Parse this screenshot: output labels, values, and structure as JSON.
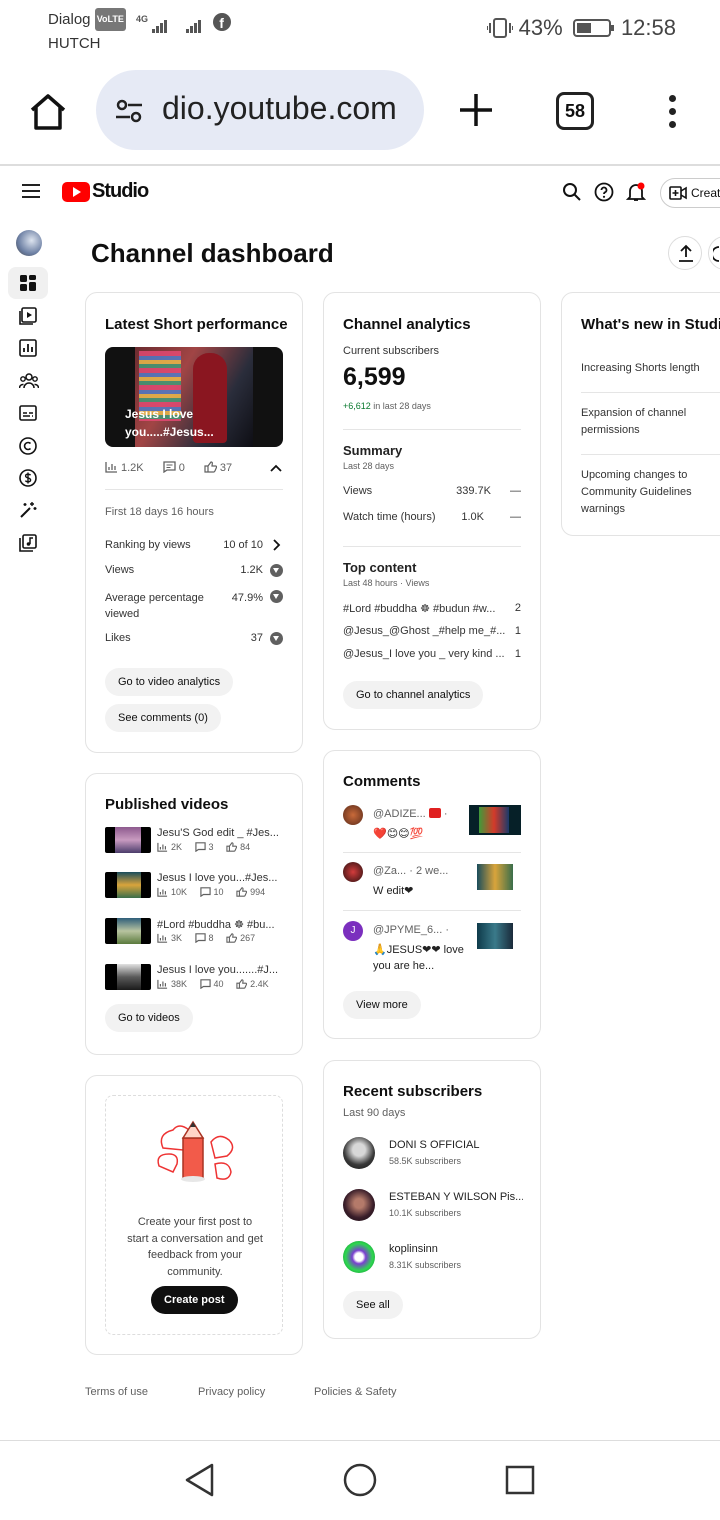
{
  "status_bar": {
    "carrier_1": "Dialog",
    "volte": "VoLTE",
    "network": "4G",
    "carrier_2": "HUTCH",
    "battery": "43%",
    "time": "12:58"
  },
  "browser": {
    "url": "dio.youtube.com",
    "tab_count": "58"
  },
  "header": {
    "logo_text": "Studio",
    "create_label": "Create"
  },
  "page": {
    "title": "Channel dashboard"
  },
  "latest_short": {
    "title": "Latest Short performance",
    "thumb_caption_1": "Jesus I love",
    "thumb_caption_2": "you.....#Jesus...",
    "views": "1.2K",
    "comments": "0",
    "likes": "37",
    "period": "First 18 days 16 hours",
    "ranking_label": "Ranking by views",
    "ranking_value": "10 of 10",
    "views_label": "Views",
    "views_value": "1.2K",
    "avg_label": "Average percentage viewed",
    "avg_value": "47.9%",
    "likes_label": "Likes",
    "likes_value": "37",
    "btn_analytics": "Go to video analytics",
    "btn_comments": "See comments (0)"
  },
  "channel_analytics": {
    "title": "Channel analytics",
    "subs_label": "Current subscribers",
    "subs_value": "6,599",
    "subs_delta": "+6,612",
    "subs_delta_period": "in last 28 days",
    "summary_title": "Summary",
    "summary_period": "Last 28 days",
    "views_label": "Views",
    "views_value": "339.7K",
    "views_trend": "—",
    "watch_label": "Watch time (hours)",
    "watch_value": "1.0K",
    "watch_trend": "—",
    "top_title": "Top content",
    "top_period": "Last 48 hours · Views",
    "top_items": [
      {
        "title": "#Lord #buddha ☸ #budun #w...",
        "views": "2"
      },
      {
        "title": "@Jesus_@Ghost _#help me_#...",
        "views": "1"
      },
      {
        "title": "@Jesus_I love you _ very kind ...",
        "views": "1"
      }
    ],
    "btn": "Go to channel analytics"
  },
  "whats_new": {
    "title": "What's new in Studio",
    "items": [
      "Increasing Shorts length",
      "Expansion of channel permissions",
      "Upcoming changes to Community Guidelines warnings"
    ]
  },
  "published": {
    "title": "Published videos",
    "videos": [
      {
        "title": "Jesu'S God edit _ #Jes...",
        "views": "2K",
        "comments": "3",
        "likes": "84"
      },
      {
        "title": "Jesus I love you...#Jes...",
        "views": "10K",
        "comments": "10",
        "likes": "994"
      },
      {
        "title": "#Lord #buddha ☸ #bu...",
        "views": "3K",
        "comments": "8",
        "likes": "267"
      },
      {
        "title": "Jesus I love you.......#J...",
        "views": "38K",
        "comments": "40",
        "likes": "2.4K"
      }
    ],
    "btn": "Go to videos"
  },
  "comments": {
    "title": "Comments",
    "items": [
      {
        "author": "@ADIZE...",
        "meta": "·",
        "text": "❤️😊😊💯"
      },
      {
        "author": "@Za...",
        "meta": "· 2 we...",
        "text": "W edit❤"
      },
      {
        "author": "@JPYME_6...",
        "meta": "·",
        "initial": "J",
        "text": "🙏JESUS❤❤ love you are he..."
      }
    ],
    "btn": "View more"
  },
  "community": {
    "text": "Create your first post to start a conversation and get feedback from your community.",
    "btn": "Create post"
  },
  "recent_subs": {
    "title": "Recent subscribers",
    "period": "Last 90 days",
    "items": [
      {
        "name": "DONI S OFFICIAL",
        "subs": "58.5K subscribers"
      },
      {
        "name": "ESTEBAN Y WILSON Pis...",
        "subs": "10.1K subscribers"
      },
      {
        "name": "koplinsinn",
        "subs": "8.31K subscribers"
      }
    ],
    "btn": "See all"
  },
  "footer": {
    "terms": "Terms of use",
    "privacy": "Privacy policy",
    "policies": "Policies & Safety"
  },
  "colors": {
    "youtube_red": "#ff0000",
    "delta_green": "#0a7a2f",
    "pill_bg": "#f2f2f2"
  }
}
